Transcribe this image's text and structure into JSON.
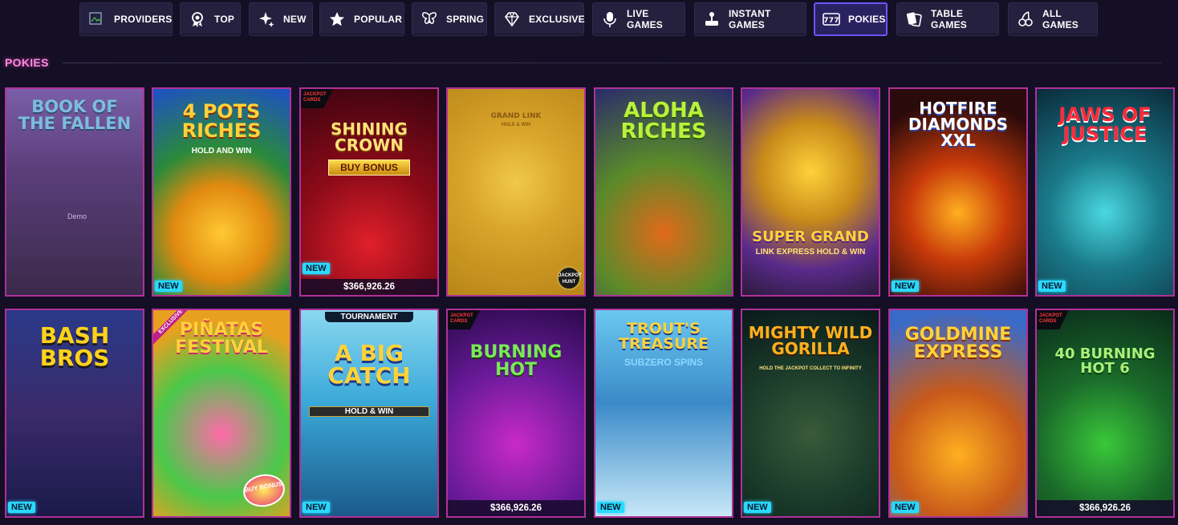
{
  "nav": {
    "tabs": [
      {
        "label": "PROVIDERS",
        "icon": "broken-image-icon",
        "active": false
      },
      {
        "label": "TOP",
        "icon": "award-ribbon-icon",
        "active": false
      },
      {
        "label": "NEW",
        "icon": "sparkle-icon",
        "active": false
      },
      {
        "label": "POPULAR",
        "icon": "star-icon",
        "active": false
      },
      {
        "label": "SPRING",
        "icon": "butterfly-icon",
        "active": false
      },
      {
        "label": "EXCLUSIVE",
        "icon": "diamond-icon",
        "active": false
      },
      {
        "label": "LIVE GAMES",
        "icon": "microphone-icon",
        "active": false
      },
      {
        "label": "INSTANT GAMES",
        "icon": "joystick-icon",
        "active": false
      },
      {
        "label": "POKIES",
        "icon": "slot-777-icon",
        "active": true
      },
      {
        "label": "TABLE GAMES",
        "icon": "cards-icon",
        "active": false
      },
      {
        "label": "ALL GAMES",
        "icon": "cherries-icon",
        "active": false
      }
    ]
  },
  "section": {
    "title": "POKIES"
  },
  "colors": {
    "background": "#140f24",
    "nav_tab": "#24203e",
    "nav_active_border": "#6a55ff",
    "card_border": "#b0309a",
    "heading": "#ff8ae0",
    "new_badge": "#2ad9ff"
  },
  "games": [
    {
      "title": "BOOK OF THE FALLEN",
      "overlay": "Demo",
      "badge": ""
    },
    {
      "title": "4 POTS RICHES",
      "subtitle": "HOLD AND WIN",
      "badge": "NEW"
    },
    {
      "title": "SHINING CROWN",
      "buy_bonus": "BUY BONUS",
      "tag": "JACKPOT CARDS",
      "badge": "NEW",
      "jackpot": "$366,926.26"
    },
    {
      "title": "GRAND LINK",
      "subtitle": "HOLD & WIN",
      "corner_badge": "JACKPOT HUNT",
      "badge": ""
    },
    {
      "title": "ALOHA RICHES",
      "badge": ""
    },
    {
      "title": "SUPER GRAND",
      "subtitle": "LINK EXPRESS HOLD & WIN",
      "badge": ""
    },
    {
      "title": "HOTFIRE DIAMONDS XXL",
      "badge": "NEW"
    },
    {
      "title": "JAWS OF JUSTICE",
      "badge": "NEW"
    },
    {
      "title": "BASH BROS",
      "badge": "NEW"
    },
    {
      "title": "PIÑATAS FESTIVAL",
      "ribbon": "EXCLUSIVE",
      "corner_badge": "BUY BONUS",
      "badge": ""
    },
    {
      "title": "A BIG CATCH",
      "subtitle": "HOLD & WIN",
      "top_tag": "TOURNAMENT",
      "badge": "NEW"
    },
    {
      "title": "BURNING HOT",
      "tag": "JACKPOT CARDS",
      "badge": "",
      "jackpot": "$366,926.26"
    },
    {
      "title": "TROUT'S TREASURE",
      "subtitle": "SUBZERO SPINS",
      "badge": "NEW"
    },
    {
      "title": "MIGHTY WILD GORILLA",
      "subtitle": "HOLD THE JACKPOT COLLECT TO INFINITY",
      "badge": "NEW"
    },
    {
      "title": "GOLDMINE EXPRESS",
      "badge": "NEW"
    },
    {
      "title": "40 BURNING HOT 6",
      "tag": "JACKPOT CARDS",
      "badge": "",
      "jackpot": "$366,926.26"
    }
  ]
}
